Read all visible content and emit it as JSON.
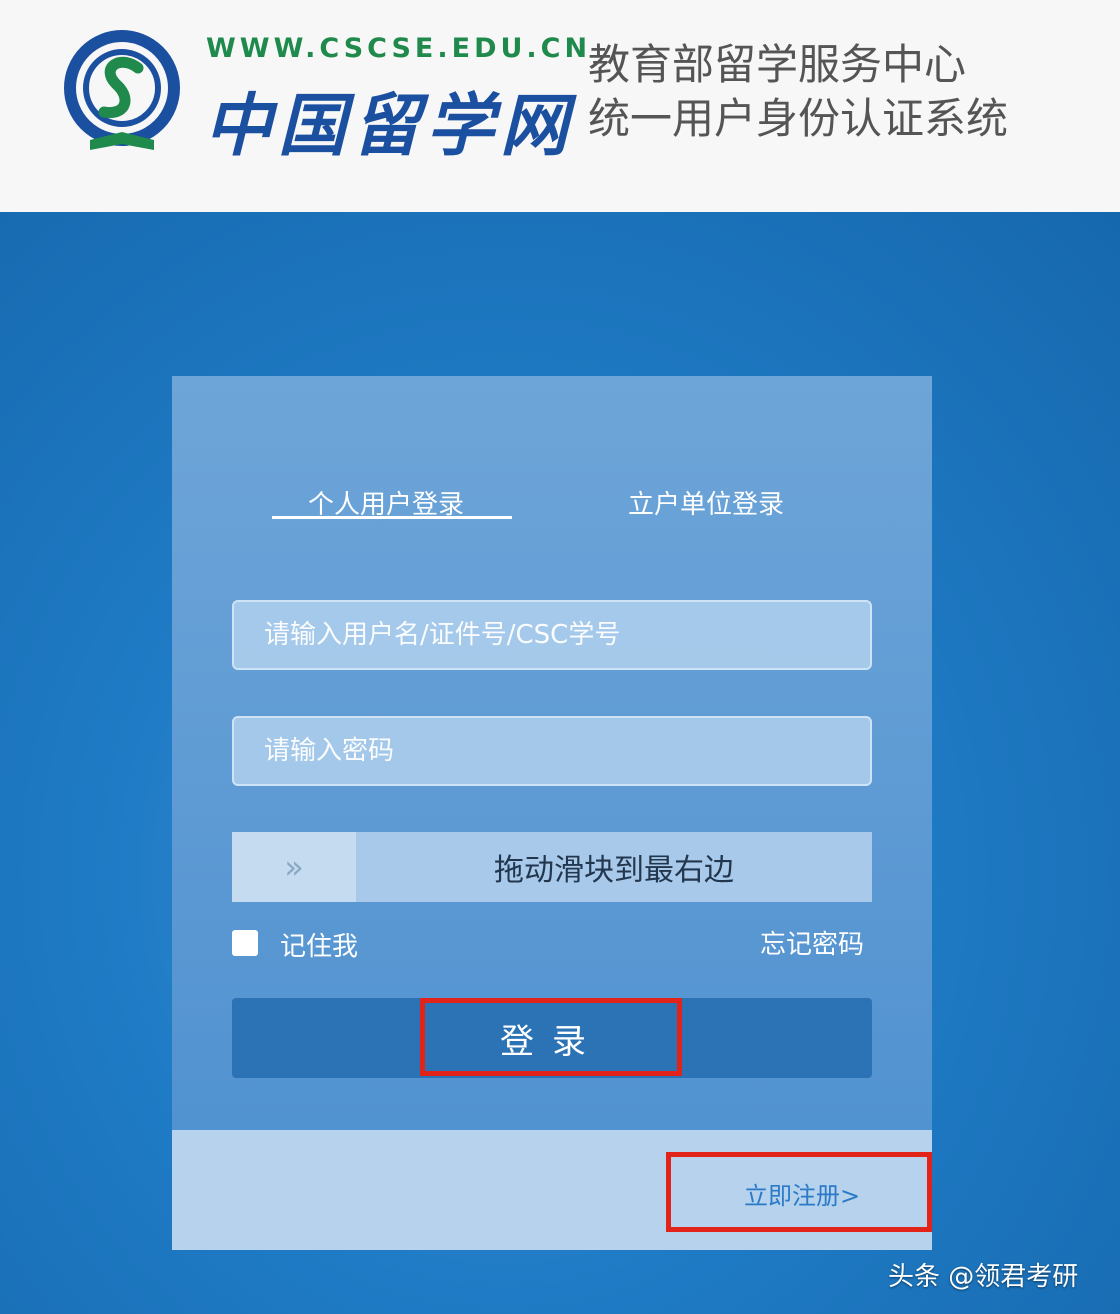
{
  "header": {
    "site_url": "WWW.CSCSE.EDU.CN",
    "site_name": "中国留学网",
    "system_title_line1": "教育部留学服务中心",
    "system_title_line2": "统一用户身份认证系统"
  },
  "tabs": [
    {
      "label": "个人用户登录",
      "active": true
    },
    {
      "label": "立户单位登录",
      "active": false
    }
  ],
  "form": {
    "username_placeholder": "请输入用户名/证件号/CSC学号",
    "password_placeholder": "请输入密码",
    "slider_icon": "»",
    "slider_text": "拖动滑块到最右边",
    "remember_label": "记住我",
    "forgot_label": "忘记密码",
    "login_label": "登录"
  },
  "footer": {
    "register_label": "立即注册>"
  },
  "watermark": "头条 @领君考研",
  "colors": {
    "page_bg": "#1a78c2",
    "highlight": "#e2231a",
    "logo_green": "#1f8a4c",
    "logo_blue": "#1b4fa0"
  }
}
